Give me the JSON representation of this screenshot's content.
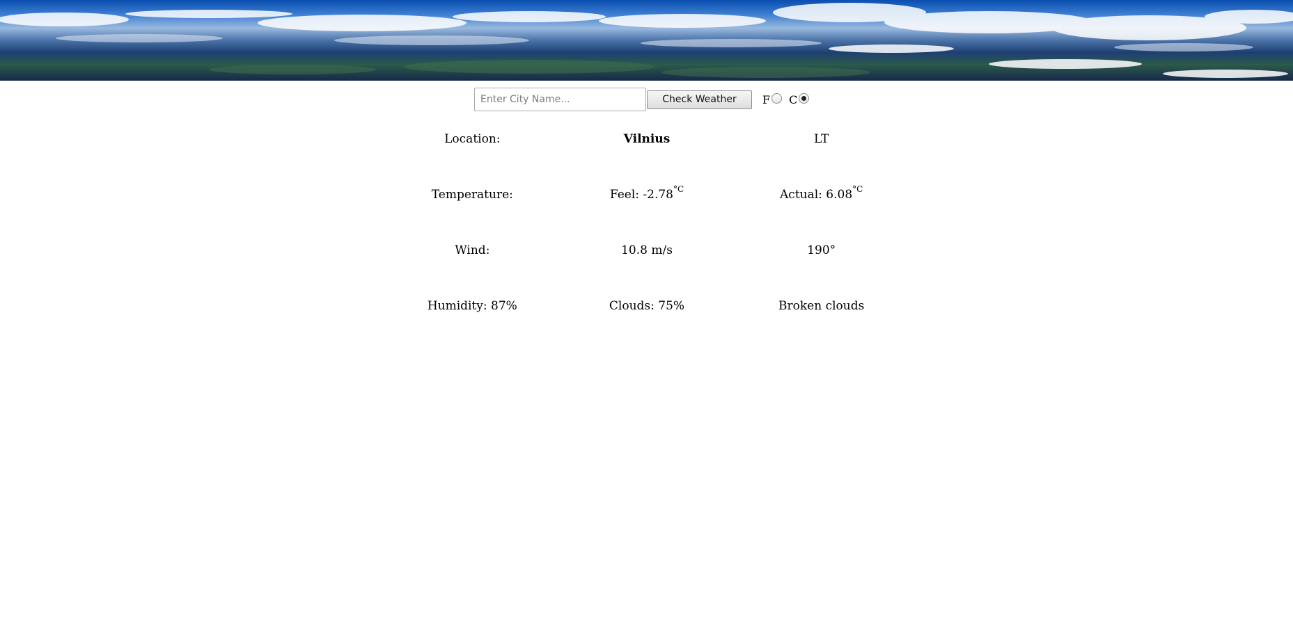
{
  "search": {
    "placeholder": "Enter City Name...",
    "button_label": "Check Weather"
  },
  "units": {
    "fahrenheit_label": "F",
    "celsius_label": "C",
    "selected": "C"
  },
  "weather": {
    "location_label": "Location:",
    "city": "Vilnius",
    "country": "LT",
    "temperature_label": "Temperature:",
    "feel_text": "Feel: -2.78",
    "actual_text": "Actual: 6.08",
    "temp_unit": "°C",
    "wind_label": "Wind:",
    "wind_speed": "10.8 m/s",
    "wind_direction": "190°",
    "humidity": "Humidity: 87%",
    "clouds": "Clouds: 75%",
    "description": "Broken clouds"
  }
}
